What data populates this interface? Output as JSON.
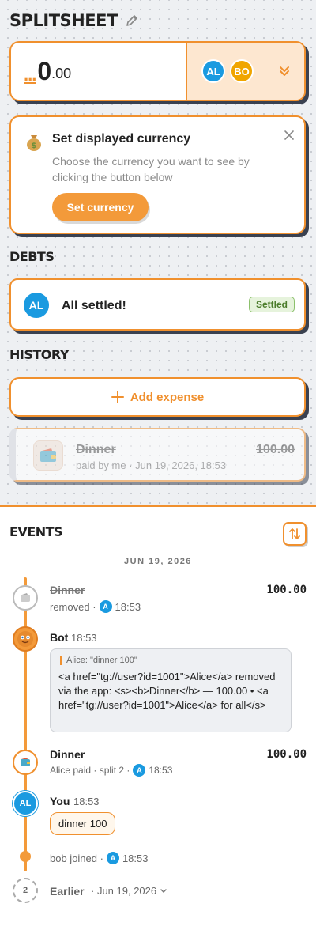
{
  "app": {
    "title": "SPLITSHEET"
  },
  "balance": {
    "dots": "...",
    "whole": "0",
    "fraction": ".00",
    "members": [
      {
        "initials": "AL",
        "color": "#1a9ae0"
      },
      {
        "initials": "BO",
        "color": "#f0a500"
      }
    ]
  },
  "currency_card": {
    "title": "Set displayed currency",
    "description": "Choose the currency you want to see by clicking the button below",
    "button": "Set currency"
  },
  "debts": {
    "label": "DEBTS",
    "avatar": "AL",
    "text": "All settled!",
    "badge": "Settled"
  },
  "history": {
    "label": "HISTORY",
    "add_button": "Add expense",
    "items": [
      {
        "name": "Dinner",
        "meta": "paid by me · Jun 19, 2026, 18:53",
        "amount": "100.00"
      }
    ]
  },
  "events": {
    "label": "EVENTS",
    "date": "JUN 19, 2026",
    "items": [
      {
        "name": "Dinner",
        "amount": "100.00",
        "meta_prefix": "removed ·",
        "avatar": "A",
        "time": "18:53"
      },
      {
        "name": "Bot",
        "time": "18:53",
        "quote": "Alice: \"dinner 100\"",
        "text": "<a href=\"tg://user?id=1001\">Alice</a> removed via the app: <s><b>Dinner</b> — 100.00 • <a href=\"tg://user?id=1001\">Alice</a> for all</s>"
      },
      {
        "name": "Dinner",
        "amount": "100.00",
        "meta_prefix": "Alice paid · split 2 ·",
        "avatar": "A",
        "time": "18:53"
      },
      {
        "name": "You",
        "time": "18:53",
        "avatar": "AL",
        "bubble": "dinner 100"
      },
      {
        "meta_prefix": "bob joined ·",
        "avatar": "A",
        "time": "18:53"
      },
      {
        "count": "2",
        "name": "Earlier",
        "meta": "· Jun 19, 2026"
      }
    ]
  },
  "colors": {
    "accent": "#f0902e",
    "blue": "#1a9ae0",
    "gold": "#f0a500"
  }
}
